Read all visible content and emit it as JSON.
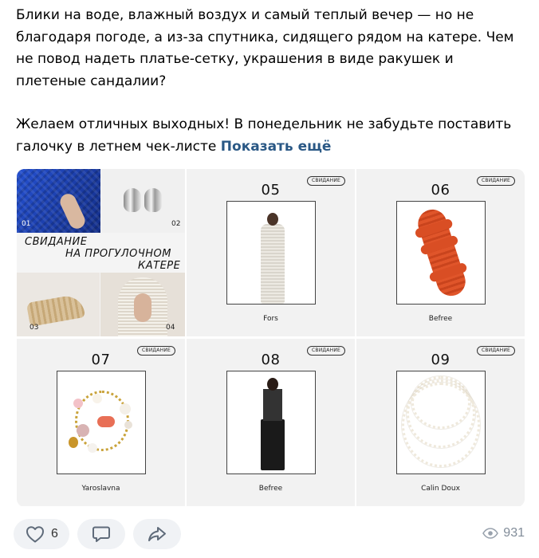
{
  "post": {
    "paragraph1": "Блики на воде, влажный воздух и самый теплый вечер — но не благодаря погоде, а из-за спутника, сидящего рядом на катере. Чем не повод надеть платье-сетку, украшения в виде ракушек и плетеные сандалии?",
    "paragraph2": "Желаем отличных выходных! В понедельник не забудьте поставить галочку в летнем чек-листе",
    "show_more": "Показать ещё"
  },
  "collage": {
    "title_line1": "СВИДАНИЕ",
    "title_line2": "НА ПРОГУЛОЧНОМ",
    "title_line3": "КАТЕРЕ",
    "nums": [
      "01",
      "02",
      "03",
      "04"
    ]
  },
  "products": [
    {
      "badge": "СВИДАНИЕ",
      "number": "05",
      "brand": "Fors"
    },
    {
      "badge": "СВИДАНИЕ",
      "number": "06",
      "brand": "Befree"
    },
    {
      "badge": "СВИДАНИЕ",
      "number": "07",
      "brand": "Yaroslavna"
    },
    {
      "badge": "СВИДАНИЕ",
      "number": "08",
      "brand": "Befree"
    },
    {
      "badge": "СВИДАНИЕ",
      "number": "09",
      "brand": "Calin Doux"
    }
  ],
  "footer": {
    "likes": "6",
    "views": "931",
    "icons": {
      "like": "heart-icon",
      "comment": "comment-icon",
      "share": "share-icon",
      "views": "eye-icon"
    }
  },
  "colors": {
    "link": "#2a5885",
    "pill_bg": "#f0f2f5",
    "muted": "#818c99"
  }
}
